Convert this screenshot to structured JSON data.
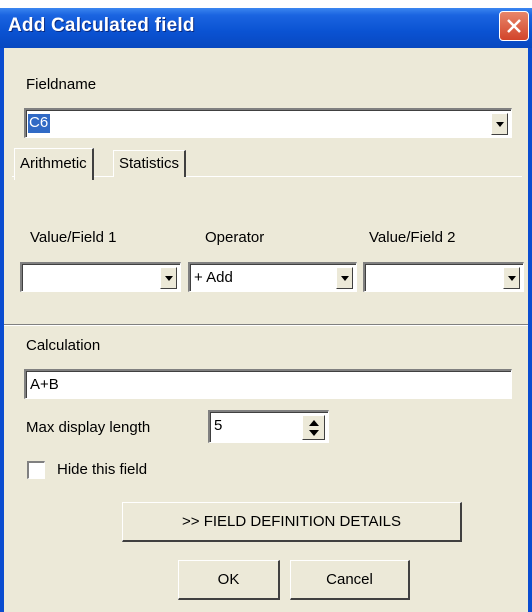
{
  "window": {
    "title": "Add Calculated field"
  },
  "fieldname": {
    "label": "Fieldname",
    "value": "C6"
  },
  "tabs": [
    {
      "label": "Arithmetic"
    },
    {
      "label": "Statistics"
    }
  ],
  "arithmetic": {
    "value1_label": "Value/Field 1",
    "operator_label": "Operator",
    "value2_label": "Value/Field 2",
    "value1": "",
    "operator": "+ Add",
    "value2": ""
  },
  "calculation": {
    "label": "Calculation",
    "value": "A+B"
  },
  "max_display": {
    "label": "Max display length",
    "value": "5"
  },
  "hide_field": {
    "label": "Hide this field",
    "checked": false
  },
  "buttons": {
    "details": ">> FIELD DEFINITION DETAILS",
    "ok": "OK",
    "cancel": "Cancel"
  },
  "colors": {
    "title_bar": "#0a52d2",
    "dialog_face": "#ece9d8",
    "selection": "#316ac5",
    "close_button": "#d2442a"
  },
  "icons": {
    "close": "close-x-icon",
    "dropdown": "chevron-down-icon",
    "spinner": "up-down-arrows-icon"
  }
}
